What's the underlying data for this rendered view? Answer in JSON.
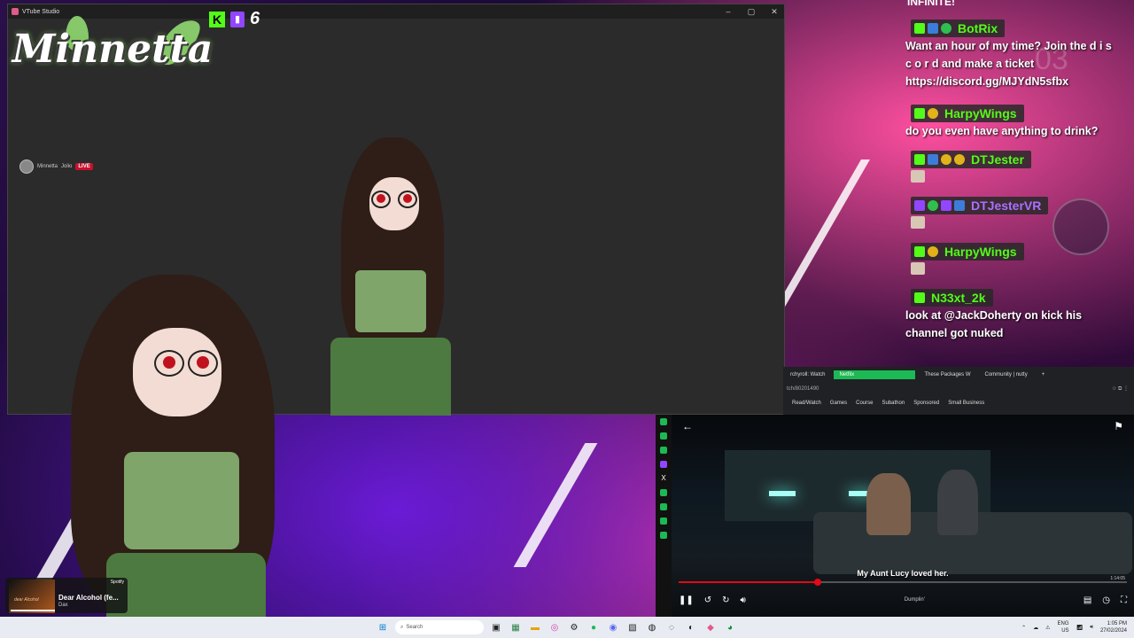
{
  "vts": {
    "window_title": "VTube Studio",
    "logo_text": "Minnetta",
    "viewer_count": "6",
    "stream_tag": {
      "name": "Minnetta",
      "game": "Jolio",
      "live": "LIVE"
    }
  },
  "chat": {
    "header": "INFINITE!",
    "messages": [
      {
        "user": "BotRix",
        "user_color": "#53fc18",
        "text": "Want an hour of my time? Join the d i s c o r d and make a ticket https://discord.gg/MJYdN5sfbx"
      },
      {
        "user": "HarpyWings",
        "user_color": "#53fc18",
        "text": "do you even have anything to drink?"
      },
      {
        "user": "DTJester",
        "user_color": "#53fc18",
        "text": ""
      },
      {
        "user": "DTJesterVR",
        "user_color": "#a970ff",
        "text": ""
      },
      {
        "user": "HarpyWings",
        "user_color": "#53fc18",
        "text": ""
      },
      {
        "user": "N33xt_2k",
        "user_color": "#53fc18",
        "text": "look at @JackDoherty on kick his channel got nuked"
      }
    ],
    "ghost_time": "03"
  },
  "browser": {
    "tabs": [
      "rchyroll: Watch",
      "Netflix",
      "These Packages W",
      "Community | nutty"
    ],
    "active_tab": "Netflix",
    "url": "tch/80201490",
    "bookmarks": [
      "Read/Watch",
      "Games",
      "Course",
      "Subathon",
      "Sponsored",
      "Small Business"
    ]
  },
  "player": {
    "subtitle": "My Aunt Lucy loved her.",
    "title": "Dumplin'",
    "progress": 0.31,
    "time": "1:14:05"
  },
  "spotify": {
    "brand": "Spotify",
    "track": "Dear Alcohol (fe...",
    "artist": "Dax",
    "album_text": "dear Alcohol"
  },
  "taskbar": {
    "search_placeholder": "Search",
    "lang": "ENG",
    "region": "US",
    "time": "1:05 PM",
    "date": "27/02/2024"
  },
  "colors": {
    "kick": "#53fc18",
    "twitch": "#9146ff",
    "netflix_red": "#e50914",
    "spotify_green": "#1db954"
  }
}
